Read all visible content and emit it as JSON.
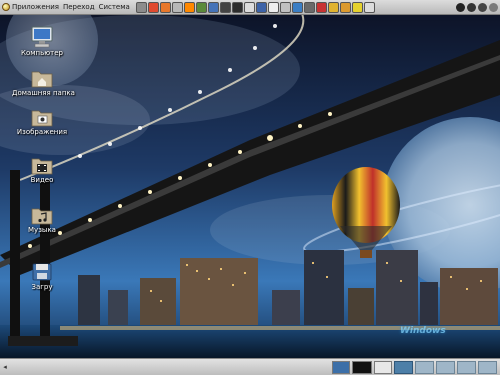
{
  "top_panel": {
    "menus": [
      {
        "label": "Приложения"
      },
      {
        "label": "Переход"
      },
      {
        "label": "Система"
      }
    ],
    "launchers": [
      {
        "icon": "clipboard-icon",
        "color": "#8c8c8c"
      },
      {
        "icon": "lifebuoy-icon",
        "color": "#e04a2f"
      },
      {
        "icon": "firefox-icon",
        "color": "#e8772a"
      },
      {
        "icon": "dvd-icon",
        "color": "#b8b8b8"
      },
      {
        "icon": "vlc-icon",
        "color": "#ff8800"
      },
      {
        "icon": "image-viewer-icon",
        "color": "#5b8a3a"
      },
      {
        "icon": "network-icon",
        "color": "#4573b8"
      },
      {
        "icon": "archive-icon",
        "color": "#444444"
      },
      {
        "icon": "film-icon",
        "color": "#2d2d2d"
      },
      {
        "icon": "disc-icon",
        "color": "#dddddd"
      },
      {
        "icon": "media-player-icon",
        "color": "#3d63a8"
      },
      {
        "icon": "clock-icon",
        "color": "#eeeeee"
      },
      {
        "icon": "editor-icon",
        "color": "#c0c0c0"
      },
      {
        "icon": "monitor-icon",
        "color": "#3b7ec4"
      },
      {
        "icon": "pen-icon",
        "color": "#6a6a6a"
      },
      {
        "icon": "calendar-icon",
        "color": "#c73333"
      },
      {
        "icon": "cd-player-icon",
        "color": "#e0b330"
      },
      {
        "icon": "burner-icon",
        "color": "#dc9a2e"
      },
      {
        "icon": "banana-icon",
        "color": "#e5d12d"
      },
      {
        "icon": "cd-icon",
        "color": "#dcdcdc"
      }
    ],
    "tray": [
      {
        "icon": "eject-icon",
        "color": "#222222"
      },
      {
        "icon": "search-icon",
        "color": "#333333"
      },
      {
        "icon": "settings-icon",
        "color": "#444444"
      },
      {
        "icon": "power-icon",
        "color": "#7a7a7a"
      }
    ]
  },
  "desktop_icons": [
    {
      "label": "Компьютер",
      "icon": "computer-icon"
    },
    {
      "label": "Домашняя папка",
      "icon": "home-folder-icon"
    },
    {
      "label": "Изображения",
      "icon": "pictures-folder-icon"
    },
    {
      "label": "Видео",
      "icon": "video-folder-icon"
    },
    {
      "label": "Музыка",
      "icon": "music-folder-icon"
    },
    {
      "label": "Загру",
      "icon": "downloads-icon"
    }
  ],
  "watermark": "Windows",
  "bottom_panel": {
    "scroll_left": "◂",
    "workspaces": [
      "1",
      "2",
      "3",
      "4",
      "5"
    ],
    "active_workspace": 0
  }
}
